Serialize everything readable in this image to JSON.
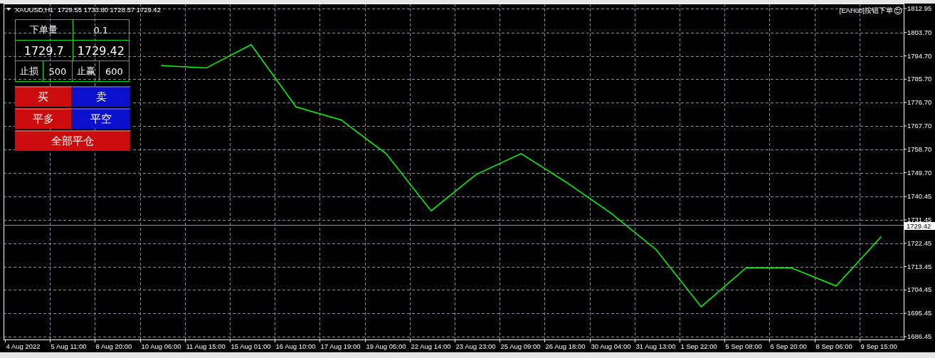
{
  "chart": {
    "symbol_header": "XAUUSD,H1  1729.55 1733.80 1728.57 1729.42",
    "indicator_label": "[EAHub]按钮下单",
    "chart_data": {
      "type": "line",
      "grid": true,
      "ref_lines": [
        {
          "axis": "y",
          "value": 1729.42,
          "label": "1729.42"
        }
      ],
      "categories": [
        "4 Aug 2022",
        "5 Aug 11:00",
        "8 Aug 20:00",
        "10 Aug 06:00",
        "11 Aug 15:00",
        "15 Aug 01:00",
        "16 Aug 10:00",
        "17 Aug 19:00",
        "19 Aug 05:00",
        "22 Aug 14:00",
        "23 Aug 23:00",
        "25 Aug 09:00",
        "26 Aug 18:00",
        "30 Aug 04:00",
        "31 Aug 13:00",
        "1 Sep 22:00",
        "5 Sep 08:00",
        "6 Sep 20:00",
        "8 Sep 06:00",
        "9 Sep 15:00"
      ],
      "ylim": [
        1686.45,
        1812.95
      ],
      "yticks": [
        {
          "value": 1812.95,
          "label": "1812.95"
        },
        {
          "value": 1803.7,
          "label": "1803.70"
        },
        {
          "value": 1794.7,
          "label": "1794.70"
        },
        {
          "value": 1785.7,
          "label": "1785.70"
        },
        {
          "value": 1776.7,
          "label": "1776.70"
        },
        {
          "value": 1767.7,
          "label": "1767.70"
        },
        {
          "value": 1758.7,
          "label": "1758.70"
        },
        {
          "value": 1749.7,
          "label": "1749.70"
        },
        {
          "value": 1740.45,
          "label": "1740.45"
        },
        {
          "value": 1731.45,
          "label": "1731.45"
        },
        {
          "value": 1722.45,
          "label": "1722.45"
        },
        {
          "value": 1713.45,
          "label": "1713.45"
        },
        {
          "value": 1704.45,
          "label": "1704.45"
        },
        {
          "value": 1695.45,
          "label": "1695.45"
        },
        {
          "value": 1686.45,
          "label": "1686.45"
        }
      ],
      "series": [
        {
          "color": "#00ff00",
          "values": [
            null,
            null,
            null,
            1791,
            1790,
            1799,
            1775,
            1770,
            1757,
            1735,
            1749,
            1757,
            1746,
            1734,
            1720,
            1698,
            1713,
            1713,
            1706,
            1725
          ]
        }
      ]
    }
  },
  "trade_panel": {
    "lot_label": "下单量",
    "lot_value": "0.1",
    "bid": "1729.7",
    "ask": "1729.42",
    "stop_loss_label": "止损",
    "stop_loss_value": "500",
    "take_profit_label": "止赢",
    "take_profit_value": "600",
    "buttons": [
      {
        "label": "买",
        "color": "#cc0c0c"
      },
      {
        "label": "卖",
        "color": "#0a10cc"
      },
      {
        "label": "平多",
        "color": "#cc0c0c"
      },
      {
        "label": "平空",
        "color": "#0a10cc"
      },
      {
        "label": "全部平仓",
        "color": "#cc0c0c"
      }
    ]
  }
}
